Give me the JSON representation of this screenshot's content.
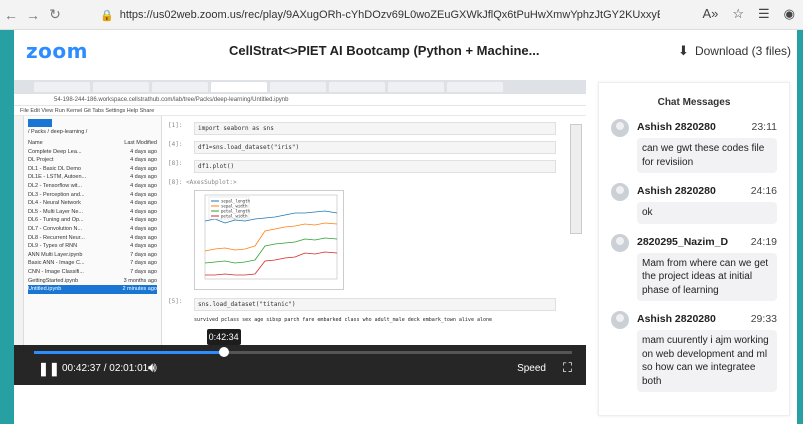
{
  "browser": {
    "url": "https://us02web.zoom.us/rec/play/9AXugORh-cYhDOzv69L0woZEuGXWkJflQx6tPuHwXmwYphzJtGY2KUxxyEWcQO1lc-v4MEkdem...",
    "icons": [
      "back-icon",
      "forward-icon",
      "refresh-icon",
      "lock-icon",
      "read-aloud-icon",
      "favorite-icon",
      "collections-icon",
      "profile-icon"
    ]
  },
  "app": {
    "logo": "zoom",
    "title": "CellStrat<>PIET AI Bootcamp (Python + Machine...",
    "download_label": "Download (3 files)"
  },
  "player": {
    "progress_fraction": 0.3525,
    "hover_time": "0:42:34",
    "current_time": "00:42:37",
    "total_time": "02:01:01",
    "time_display": "00:42:37 / 02:01:01",
    "speed_label": "Speed",
    "accent": "#2d8cff"
  },
  "recording": {
    "address": "54-198-244-186.workspace.cellstrathub.com/lab/tree/Packs/deep-learning/Untitled.ipynb",
    "menu": "File   Edit   View   Run   Kernel   Git   Tabs   Settings   Help   Share",
    "breadcrumb": "/ Packs / deep-learning /",
    "file_header": [
      "Name",
      "Last Modified"
    ],
    "files": [
      {
        "name": "Complete Deep Lea...",
        "modified": "4 days ago"
      },
      {
        "name": "DL Project",
        "modified": "4 days ago"
      },
      {
        "name": "DL1 - Basic DL Demo",
        "modified": "4 days ago"
      },
      {
        "name": "DL1E - LSTM, Autoen...",
        "modified": "4 days ago"
      },
      {
        "name": "DL2 - Tensorflow wit...",
        "modified": "4 days ago"
      },
      {
        "name": "DL3 - Perception and...",
        "modified": "4 days ago"
      },
      {
        "name": "DL4 - Neural Network",
        "modified": "4 days ago"
      },
      {
        "name": "DL5 - Multi Layer Ne...",
        "modified": "4 days ago"
      },
      {
        "name": "DL6 - Tuning and Op...",
        "modified": "4 days ago"
      },
      {
        "name": "DL7 - Convolution N...",
        "modified": "4 days ago"
      },
      {
        "name": "DL8 - Recurrent Neur...",
        "modified": "4 days ago"
      },
      {
        "name": "DL9 - Types of RNN",
        "modified": "4 days ago"
      },
      {
        "name": "ANN Multi Layer.ipynb",
        "modified": "7 days ago"
      },
      {
        "name": "Basic ANN - Image C...",
        "modified": "7 days ago"
      },
      {
        "name": "CNN - Image Classifi...",
        "modified": "7 days ago"
      },
      {
        "name": "GettingStarted.ipynb",
        "modified": "3 months ago"
      },
      {
        "name": "Untitled.ipynb",
        "modified": "2 minutes ago",
        "selected": true
      }
    ],
    "cells": [
      {
        "prompt": "[1]:",
        "code": "import seaborn as sns"
      },
      {
        "prompt": "[4]:",
        "code": "df1=sns.load_dataset(\"iris\")"
      },
      {
        "prompt": "[8]:",
        "code": "df1.plot()"
      }
    ],
    "plot_out": "[8]: <AxesSubplot:>",
    "legend": [
      "sepal_length",
      "sepal_width",
      "petal_length",
      "petal_width"
    ],
    "cell_last": {
      "prompt": "[5]:",
      "code": "sns.load_dataset(\"titanic\")"
    },
    "df_columns": "survived  pclass  sex  age  sibsp  parch  fare  embarked  class  who  adult_male  deck  embark_town  alive  alone"
  },
  "chat": {
    "title": "Chat Messages",
    "messages": [
      {
        "sender": "Ashish 2820280",
        "time": "23:11",
        "text": "can we gwt these codes file for revisiion"
      },
      {
        "sender": "Ashish 2820280",
        "time": "24:16",
        "text": "ok"
      },
      {
        "sender": "2820295_Nazim_D",
        "time": "24:19",
        "text": "Mam from where can we get the project ideas at initial phase of learning"
      },
      {
        "sender": "Ashish 2820280",
        "time": "29:33",
        "text": "mam cuurently i ajm working on web development and ml so how can we integratee both"
      }
    ]
  }
}
